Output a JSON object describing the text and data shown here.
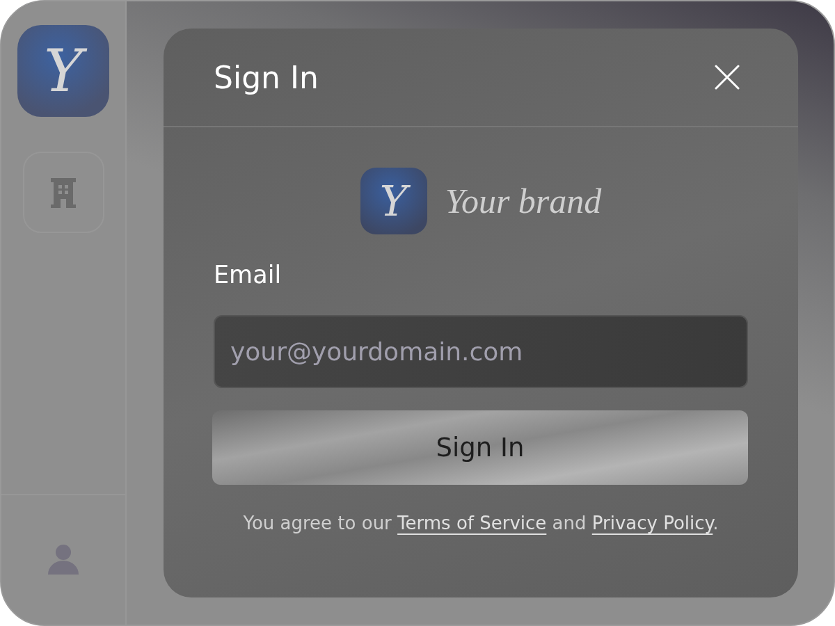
{
  "sidebar": {
    "app_icon": {
      "letter": "Y"
    },
    "items": [
      {
        "kind": "building",
        "selected": false
      }
    ],
    "footer": {
      "kind": "account"
    }
  },
  "dialog": {
    "title": "Sign In",
    "brand": {
      "mark": "Y",
      "name": "Your brand"
    },
    "email": {
      "label": "Email",
      "placeholder": "your@yourdomain.com"
    },
    "submit": "Sign In",
    "legal": {
      "before": "You agree to our ",
      "terms": "Terms of Service",
      "middle": " and ",
      "privacy": "Privacy Policy",
      "after": "."
    }
  }
}
